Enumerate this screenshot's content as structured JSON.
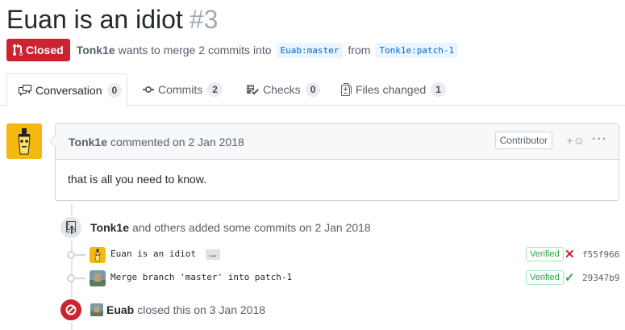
{
  "pr": {
    "title": "Euan is an idiot",
    "number": "#3",
    "state": "Closed",
    "author": "Tonk1e",
    "merge_text": "wants to merge 2 commits into",
    "base_branch": "Euab:master",
    "from_text": "from",
    "head_branch": "Tonk1e:patch-1"
  },
  "tabs": [
    {
      "label": "Conversation",
      "count": "0",
      "icon": "comment-discussion-icon"
    },
    {
      "label": "Commits",
      "count": "2",
      "icon": "git-commit-icon"
    },
    {
      "label": "Checks",
      "count": "0",
      "icon": "checklist-icon"
    },
    {
      "label": "Files changed",
      "count": "1",
      "icon": "file-diff-icon"
    }
  ],
  "comment": {
    "author": "Tonk1e",
    "action": "commented on 2 Jan 2018",
    "role": "Contributor",
    "reaction": "+☺",
    "more": "···",
    "body": "that is all you need to know."
  },
  "commits_event": {
    "author": "Tonk1e",
    "text": "and others added some commits on 2 Jan 2018",
    "commits": [
      {
        "message": "Euan is an idiot",
        "has_more": true,
        "more_label": "…",
        "verified": "Verified",
        "status": "failure",
        "status_glyph": "✕",
        "sha": "f55f966"
      },
      {
        "message": "Merge branch 'master' into patch-1",
        "has_more": false,
        "verified": "Verified",
        "status": "success",
        "status_glyph": "✓",
        "sha": "29347b9"
      }
    ]
  },
  "closed_event": {
    "author": "Euab",
    "text": "closed this on 3 Jan 2018"
  },
  "colors": {
    "closed_red": "#cb2431",
    "success_green": "#28a745",
    "link_blue": "#0366d6"
  }
}
